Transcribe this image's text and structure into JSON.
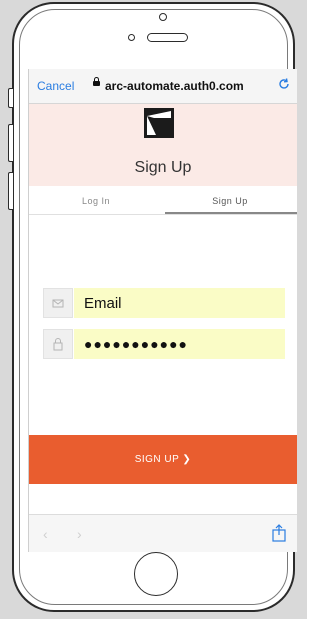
{
  "browser": {
    "cancel_label": "Cancel",
    "url": "arc-automate.auth0.com",
    "reload_icon": "reload-icon",
    "lock_icon": "lock-icon"
  },
  "auth": {
    "title": "Sign Up",
    "tabs": [
      {
        "label": "Log In",
        "active": false
      },
      {
        "label": "Sign Up",
        "active": true
      }
    ],
    "email": {
      "value": "Email",
      "icon": "envelope-icon"
    },
    "password": {
      "value": "●●●●●●●●●●●",
      "icon": "lock-icon"
    },
    "submit_label": "SIGN UP ❯"
  },
  "toolbar": {
    "back": "‹",
    "forward": "›",
    "share_icon": "share-icon"
  },
  "colors": {
    "accent": "#e95d2f",
    "header_bg": "#fbeae6",
    "input_bg": "#fafcc6",
    "link": "#2a7de1"
  }
}
